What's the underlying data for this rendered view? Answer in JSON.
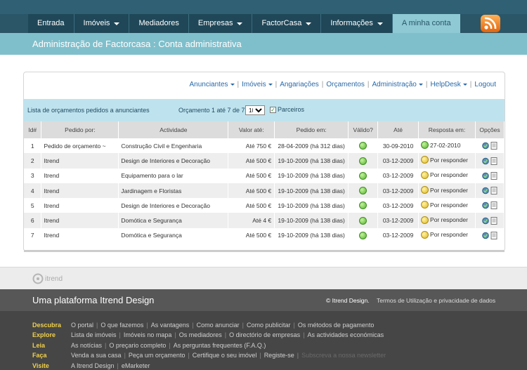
{
  "nav": {
    "items": [
      {
        "label": "Entrada",
        "dropdown": false,
        "active": false
      },
      {
        "label": "Imóveis",
        "dropdown": true,
        "active": false
      },
      {
        "label": "Mediadores",
        "dropdown": false,
        "active": false
      },
      {
        "label": "Empresas",
        "dropdown": true,
        "active": false
      },
      {
        "label": "FactorCasa",
        "dropdown": true,
        "active": false
      },
      {
        "label": "Informações",
        "dropdown": true,
        "active": false
      },
      {
        "label": "A minha conta",
        "dropdown": false,
        "active": true
      }
    ]
  },
  "page": {
    "title": "Administração de Factorcasa : Conta administrativa"
  },
  "submenu": {
    "items": [
      {
        "label": "Anunciantes",
        "dropdown": true
      },
      {
        "label": "Imóveis",
        "dropdown": true
      },
      {
        "label": "Angariações",
        "dropdown": false
      },
      {
        "label": "Orçamentos",
        "dropdown": false
      },
      {
        "label": "Administração",
        "dropdown": true
      },
      {
        "label": "HelpDesk",
        "dropdown": true
      },
      {
        "label": "Logout",
        "dropdown": false
      }
    ]
  },
  "toolbar": {
    "description": "Lista de orçamentos pedidos a anunciantes",
    "count_text": "Orçamento 1 até 7 de 7",
    "per_page": "10",
    "checkbox_label": "Parceiros"
  },
  "table": {
    "headers": [
      "Id#",
      "Pedido por:",
      "Actividade",
      "Valor até:",
      "Pedido em:",
      "Válido?",
      "Até",
      "Resposta em:",
      "Opções"
    ],
    "rows": [
      {
        "id": "1",
        "by": "Pedido de orçamento ~",
        "activity": "Construção Civil e Engenharia",
        "value": "Até 750 €",
        "date": "28-04-2009 (há 312 dias)",
        "valid": "green",
        "until": "30-09-2010",
        "response_status": "green",
        "response": "27-02-2010"
      },
      {
        "id": "2",
        "by": "Itrend",
        "activity": "Design de Interiores e Decoração",
        "value": "Até 500 €",
        "date": "19-10-2009 (há 138 dias)",
        "valid": "green",
        "until": "03-12-2009",
        "response_status": "yellow",
        "response": "Por responder"
      },
      {
        "id": "3",
        "by": "Itrend",
        "activity": "Equipamento para o lar",
        "value": "Até 500 €",
        "date": "19-10-2009 (há 138 dias)",
        "valid": "green",
        "until": "03-12-2009",
        "response_status": "yellow",
        "response": "Por responder"
      },
      {
        "id": "4",
        "by": "Itrend",
        "activity": "Jardinagem e Floristas",
        "value": "Até 500 €",
        "date": "19-10-2009 (há 138 dias)",
        "valid": "green",
        "until": "03-12-2009",
        "response_status": "yellow",
        "response": "Por responder"
      },
      {
        "id": "5",
        "by": "Itrend",
        "activity": "Design de Interiores e Decoração",
        "value": "Até 500 €",
        "date": "19-10-2009 (há 138 dias)",
        "valid": "green",
        "until": "03-12-2009",
        "response_status": "yellow",
        "response": "Por responder"
      },
      {
        "id": "6",
        "by": "Itrend",
        "activity": "Domótica e Segurança",
        "value": "Até 4 €",
        "date": "19-10-2009 (há 138 dias)",
        "valid": "green",
        "until": "03-12-2009",
        "response_status": "yellow",
        "response": "Por responder"
      },
      {
        "id": "7",
        "by": "Itrend",
        "activity": "Domótica e Segurança",
        "value": "Até 500 €",
        "date": "19-10-2009 (há 138 dias)",
        "valid": "green",
        "until": "03-12-2009",
        "response_status": "yellow",
        "response": "Por responder"
      }
    ]
  },
  "footer": {
    "logo_text": "itrend",
    "platform": "Uma plataforma Itrend Design",
    "copyright": "© Itrend Design.",
    "terms": "Termos de Utilização e privacidade de dados",
    "groups": [
      {
        "label": "Descubra",
        "links": [
          "O portal",
          "O que fazemos",
          "As vantagens",
          "Como anunciar",
          "Como publicitar",
          "Os métodos de pagamento"
        ]
      },
      {
        "label": "Explore",
        "links": [
          "Lista de imóveis",
          "Imóveis no mapa",
          "Os mediadores",
          "O directório de empresas",
          "As actividades económicas"
        ]
      },
      {
        "label": "Leia",
        "links": [
          "As notícias",
          "O preçario completo",
          "As perguntas frequentes (F.A.Q.)"
        ]
      },
      {
        "label": "Faça",
        "links": [
          "Venda a sua casa",
          "Peça um orçamento",
          "Certifique o seu imóvel",
          "Registe-se",
          "Subscreva a nossa newsletter"
        ]
      },
      {
        "label": "Visite",
        "links": [
          "A Itrend Design",
          "eMarketer"
        ]
      }
    ]
  },
  "colors": {
    "header": "#2a5668",
    "title_bar": "#7fbfcb",
    "toolbar": "#bfe3ee",
    "footer_label": "#f0d04a"
  }
}
